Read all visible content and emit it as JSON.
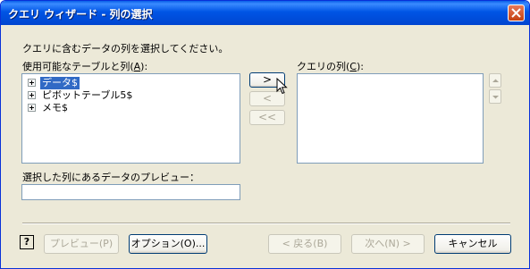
{
  "window": {
    "title": "クエリ ウィザード - 列の選択"
  },
  "instruction": "クエリに含むデータの列を選択してください。",
  "available": {
    "label_prefix": "使用可能なテーブルと列(",
    "label_key": "A",
    "label_suffix": "):",
    "items": [
      {
        "label": "データ$",
        "selected": true
      },
      {
        "label": "ピボットテーブル5$",
        "selected": false
      },
      {
        "label": "メモ$",
        "selected": false
      }
    ]
  },
  "query_columns": {
    "label_prefix": "クエリの列(",
    "label_key": "C",
    "label_suffix": "):"
  },
  "move_buttons": {
    "add": ">",
    "remove": "<",
    "remove_all": "<<"
  },
  "preview": {
    "label": "選択した列にあるデータのプレビュー：",
    "value": ""
  },
  "footer": {
    "help": "?",
    "preview_btn": "プレビュー(P)",
    "options_btn": "オプション(O)...",
    "back_btn": "< 戻る(B)",
    "next_btn": "次へ(N) >",
    "cancel_btn": "キャンセル"
  },
  "icons": [
    "close-icon",
    "expand-icon",
    "arrow-up-icon",
    "arrow-down-icon",
    "mouse-cursor-icon",
    "help-icon"
  ]
}
